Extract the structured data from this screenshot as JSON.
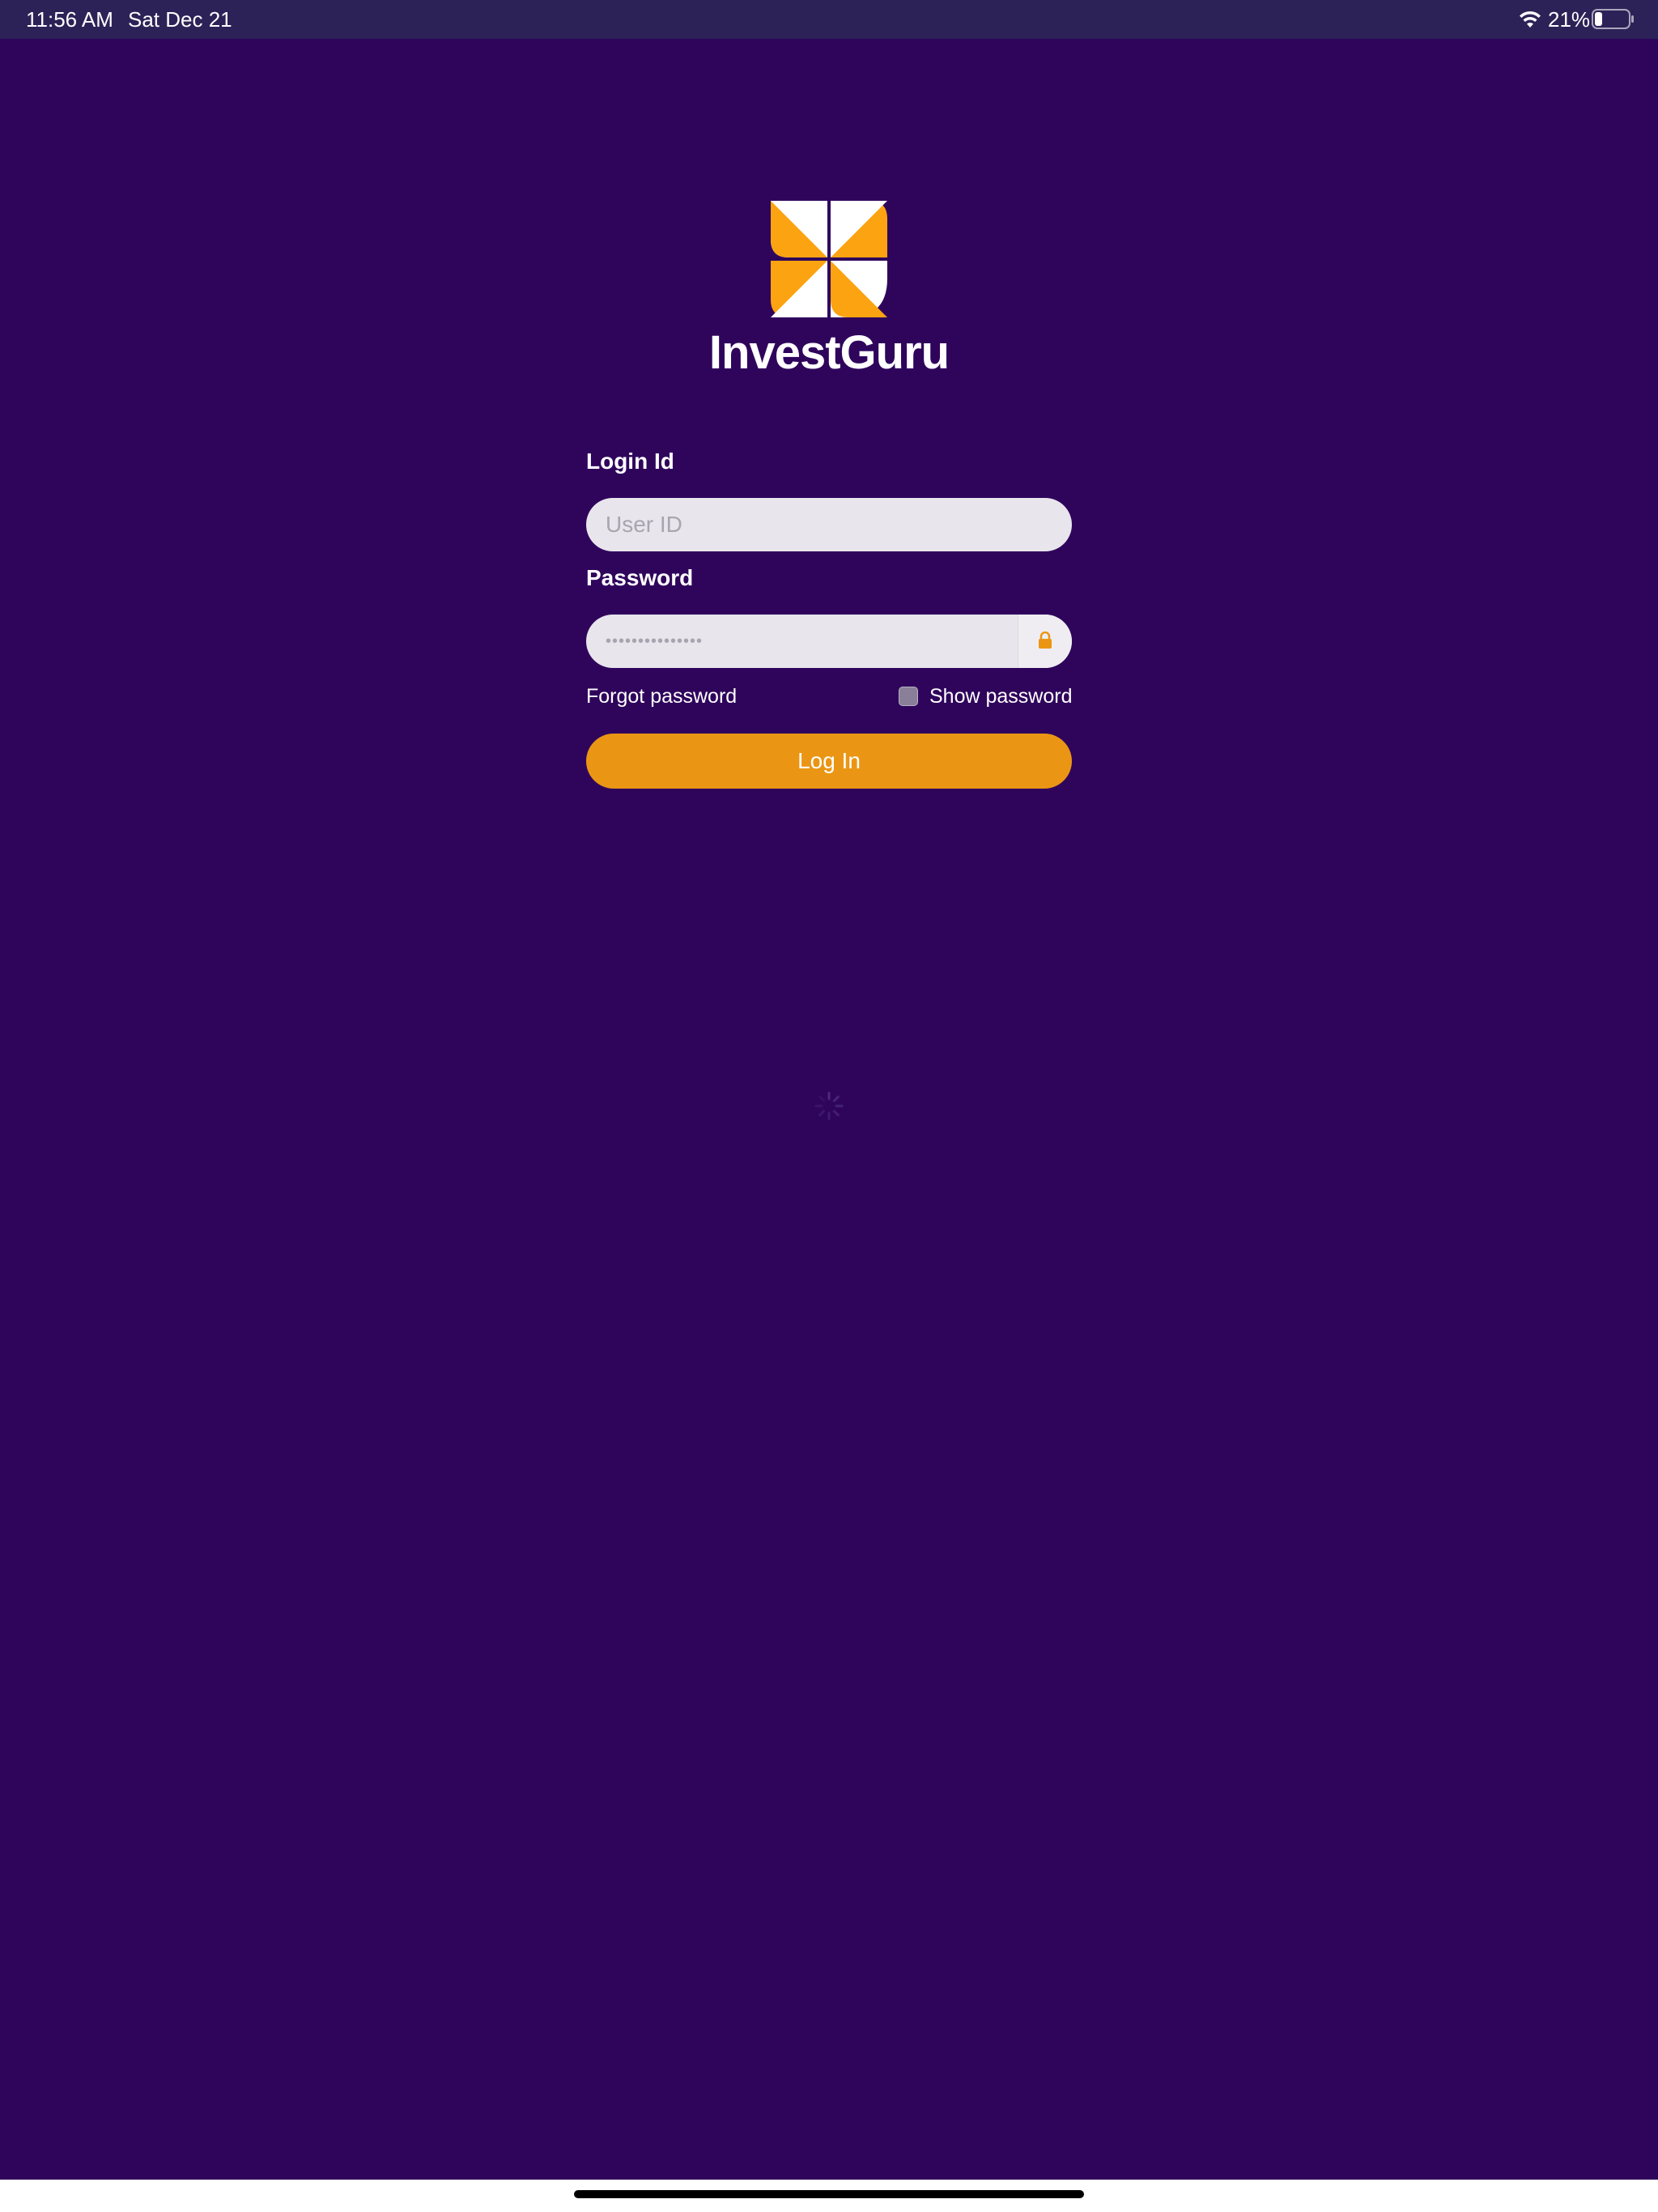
{
  "status_bar": {
    "time": "11:56 AM",
    "date": "Sat Dec 21",
    "battery": "21%",
    "icons": [
      "wifi-icon",
      "battery-icon"
    ]
  },
  "brand": {
    "name": "InvestGuru",
    "logo_icon": "pinwheel-logo-icon",
    "colors": {
      "orange": "#fca311",
      "white": "#ffffff"
    }
  },
  "form": {
    "login_label": "Login Id",
    "userid_placeholder": "User ID",
    "userid_value": "",
    "password_label": "Password",
    "password_value": "•••••••••••••••",
    "lock_icon": "lock-icon",
    "forgot_password": "Forgot password",
    "show_password": "Show password",
    "show_password_checked": false,
    "login_button": "Log In"
  },
  "theme": {
    "background": "#2f055c",
    "status_bar": "#2d2257",
    "accent": "#ea9614",
    "input_bg": "#e8e5ec"
  },
  "loading": {
    "spinner_icon": "loading-spinner-icon"
  }
}
